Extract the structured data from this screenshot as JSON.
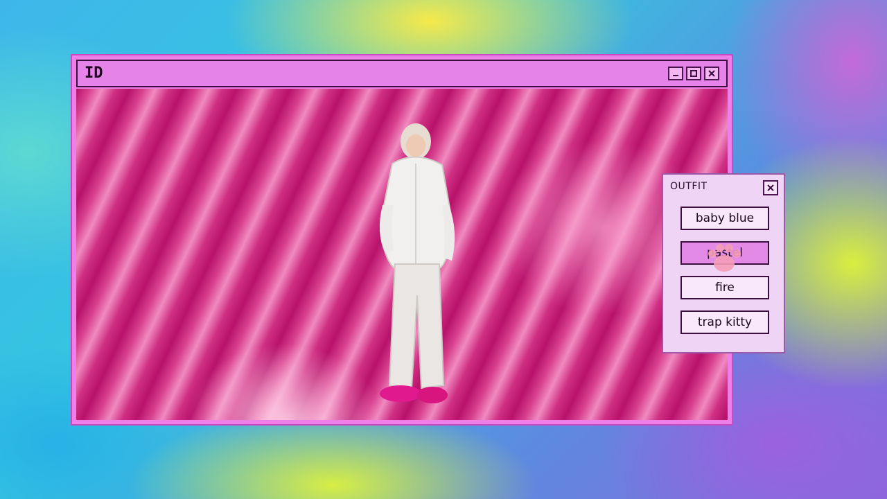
{
  "window": {
    "title": "ID",
    "controls": {
      "minimize_icon": "minimize-icon",
      "maximize_icon": "maximize-icon",
      "close_icon": "close-icon"
    }
  },
  "outfit_panel": {
    "title": "OUTFIT",
    "close_icon": "close-icon",
    "options": [
      {
        "label": "baby blue"
      },
      {
        "label": "pastel"
      },
      {
        "label": "fire"
      },
      {
        "label": "trap kitty"
      }
    ],
    "selected_option": "pastel"
  },
  "colors": {
    "window_frame": "#ee7fe8",
    "titlebar": "#e683e8",
    "panel_bg": "#f0d4f6",
    "selected_option": "#e28ae6",
    "content_background": "#d8418f"
  }
}
